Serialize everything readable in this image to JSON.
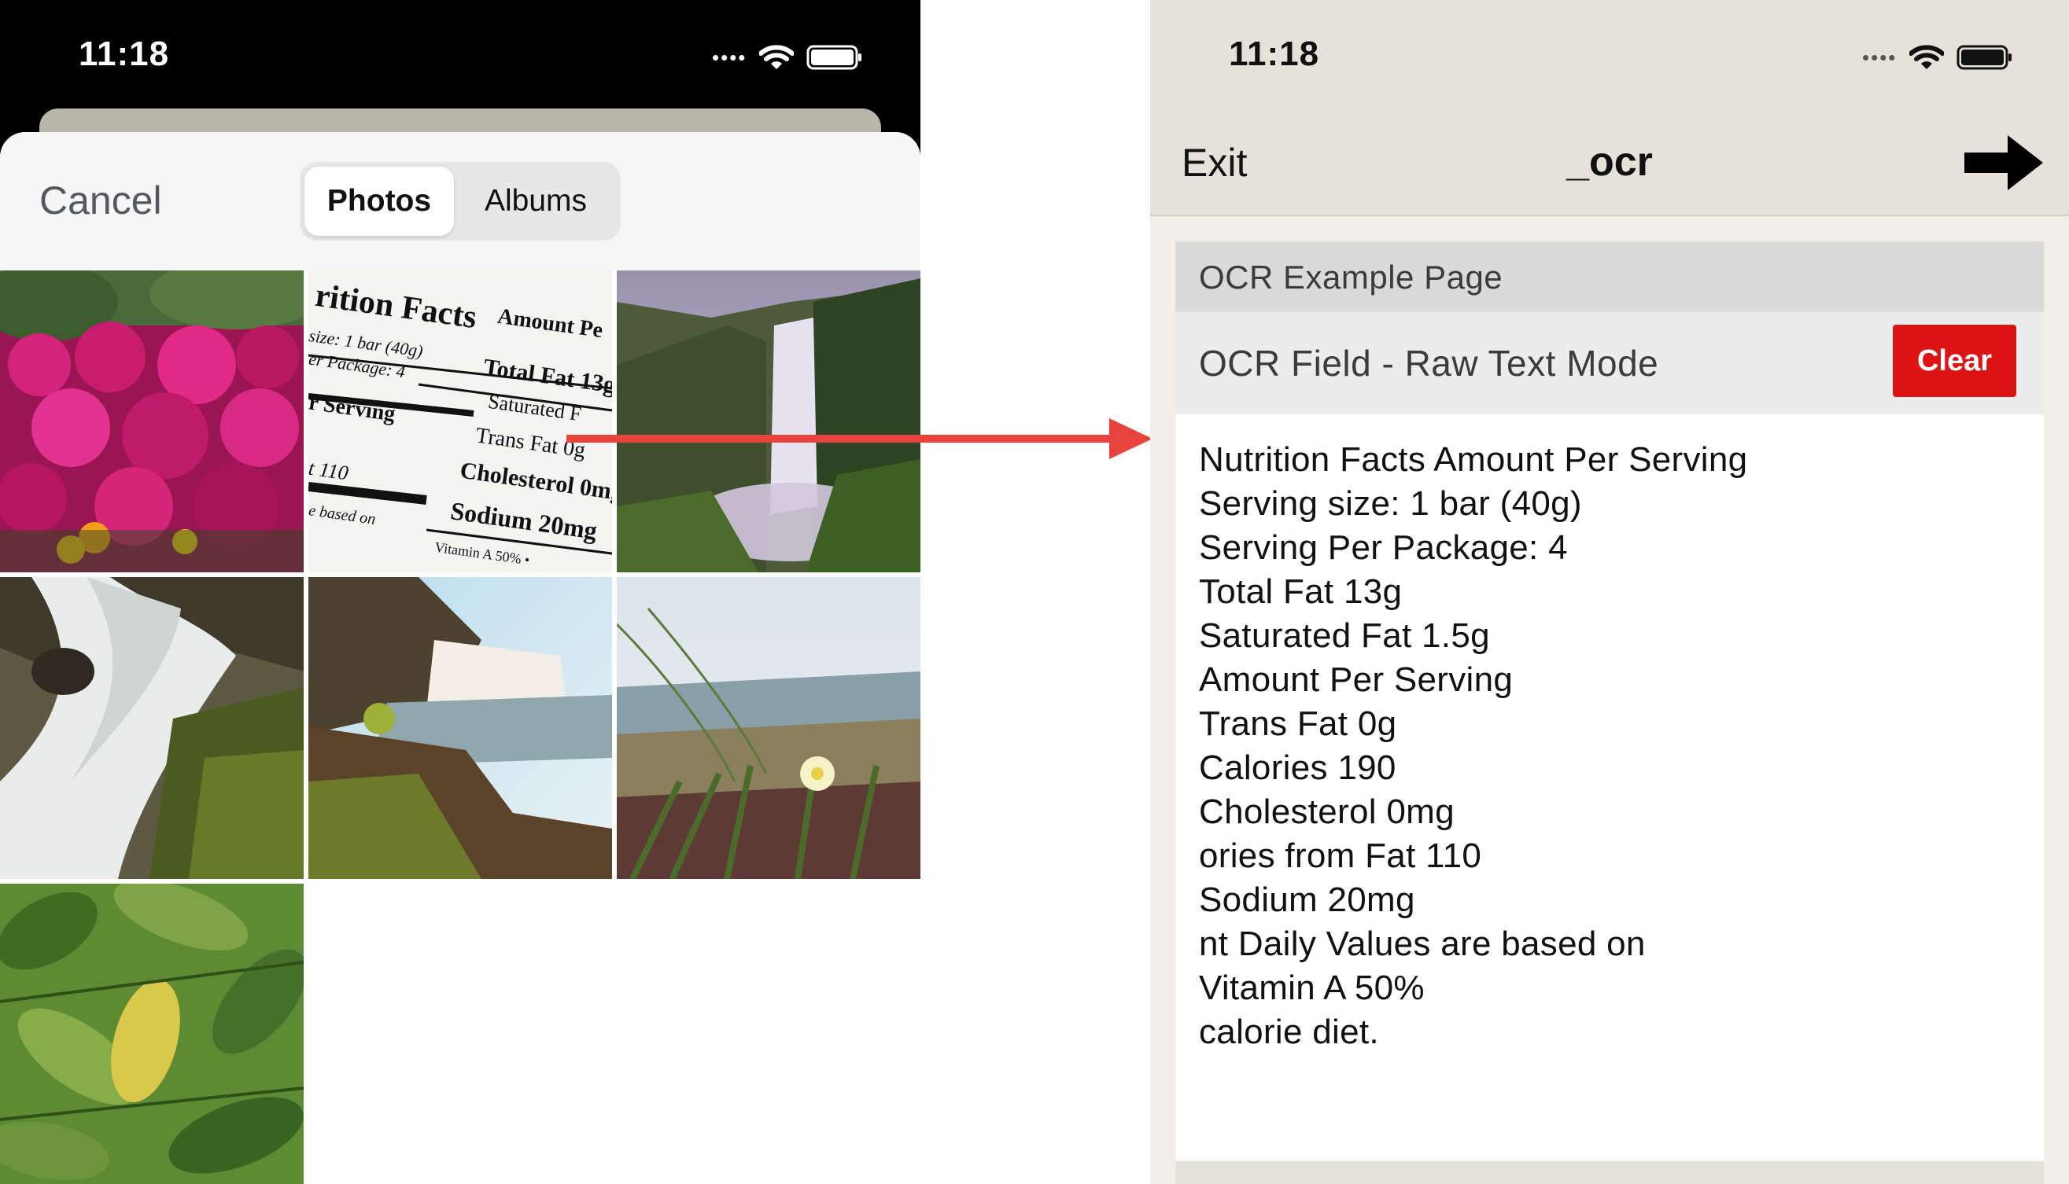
{
  "left_screen": {
    "status": {
      "time": "11:18",
      "signal_icon": "signal-dots-icon",
      "wifi_icon": "wifi-icon",
      "battery_icon": "battery-icon"
    },
    "picker": {
      "cancel_label": "Cancel",
      "tabs": [
        {
          "label": "Photos",
          "selected": true
        },
        {
          "label": "Albums",
          "selected": false
        }
      ],
      "thumbnails": [
        {
          "subject": "pink-flowers"
        },
        {
          "subject": "nutrition-label"
        },
        {
          "subject": "waterfall"
        },
        {
          "subject": "rocky-waterfall"
        },
        {
          "subject": "waterfall-landscape"
        },
        {
          "subject": "beach-flower"
        },
        {
          "subject": "green-leaves"
        }
      ],
      "nutrition_thumb_text": {
        "line1": "rition Facts",
        "line2": "size: 1 bar (40g)",
        "line3": "er Package: 4",
        "line4": "r Serving",
        "line5": "t 110",
        "line6": "e based on",
        "line7": "Amount Pe",
        "line8": "Total Fat 13g",
        "line9": "Saturated F",
        "line10": "Trans Fat 0g",
        "line11": "Cholesterol 0mg",
        "line12": "Sodium 20mg",
        "line13": "Vitamin A 50% •"
      }
    }
  },
  "right_screen": {
    "status": {
      "time": "11:18",
      "signal_icon": "signal-dots-icon",
      "wifi_icon": "wifi-icon",
      "battery_icon": "battery-icon"
    },
    "nav": {
      "exit_label": "Exit",
      "title": "_ocr",
      "next_icon": "arrow-right-icon"
    },
    "page_header": "OCR Example Page",
    "field": {
      "label": "OCR Field - Raw Text Mode",
      "clear_label": "Clear"
    },
    "ocr_text": [
      "Nutrition Facts Amount Per Serving",
      "Serving size: 1 bar (40g)",
      "Serving Per Package: 4",
      "Total Fat 13g",
      "Saturated Fat 1.5g",
      "Amount Per Serving",
      "Trans Fat 0g",
      "Calories 190",
      "Cholesterol 0mg",
      "ories from Fat 110",
      "Sodium 20mg",
      "nt Daily Values are based on",
      "Vitamin A 50%",
      "calorie diet."
    ]
  },
  "colors": {
    "clear_button": "#dc1414",
    "connector_arrow": "#e8433d",
    "right_bg": "#e5e2da"
  }
}
